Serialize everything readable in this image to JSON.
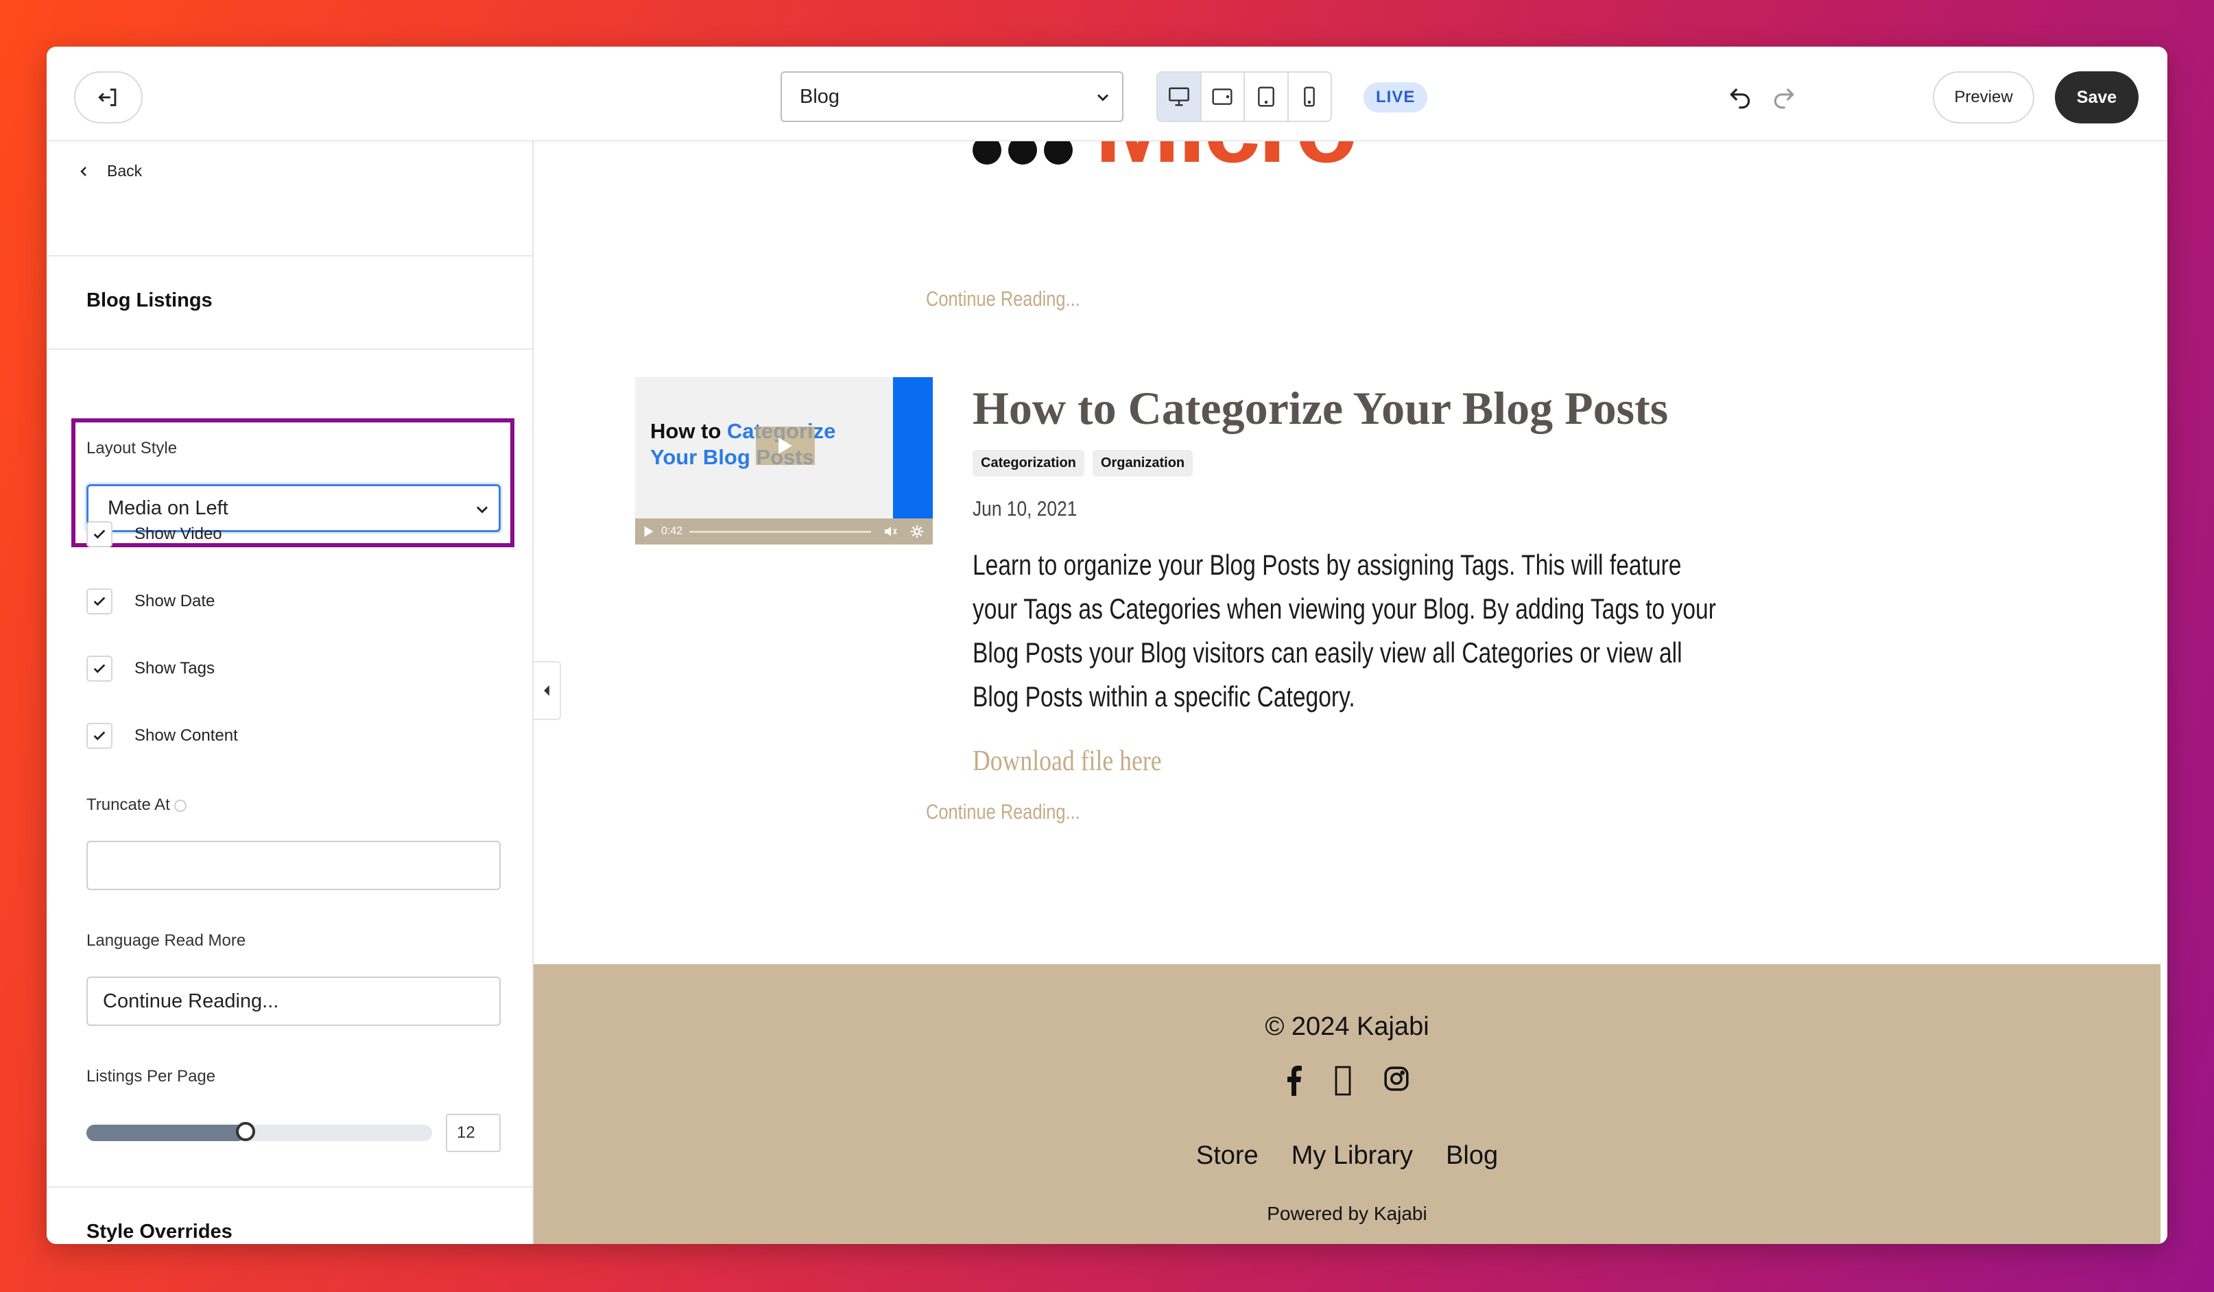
{
  "topbar": {
    "page_select_value": "Blog",
    "live_label": "LIVE",
    "preview_label": "Preview",
    "save_label": "Save"
  },
  "sidebar": {
    "back_label": "Back",
    "section_title": "Blog Listings",
    "layout_style_label": "Layout Style",
    "layout_style_value": "Media on Left",
    "checkboxes": [
      {
        "label": "Show Video",
        "checked": true
      },
      {
        "label": "Show Date",
        "checked": true
      },
      {
        "label": "Show Tags",
        "checked": true
      },
      {
        "label": "Show Content",
        "checked": true
      }
    ],
    "truncate_label": "Truncate At",
    "truncate_value": "",
    "read_more_label": "Language Read More",
    "read_more_value": "Continue Reading...",
    "listings_label": "Listings Per Page",
    "listings_value": "12",
    "listings_fraction": 0.46,
    "style_overrides_title": "Style Overrides"
  },
  "canvas": {
    "logo_text": "Micro",
    "continue_reading_1": "Continue Reading...",
    "video": {
      "title_part1": "How to ",
      "title_part2": "Categorize",
      "title_part3": "Your Blog Posts",
      "time": "0:42"
    },
    "post": {
      "title": "How to Categorize Your Blog Posts",
      "tags": [
        "Categorization",
        "Organization"
      ],
      "date": "Jun 10, 2021",
      "content": "Learn to organize your Blog Posts by assigning Tags. This will feature your Tags as Categories when viewing your Blog. By adding Tags to your Blog Posts your Blog visitors can easily view all Categories or view all Blog Posts within a specific Category.",
      "download": "Download file here",
      "continue_reading": "Continue Reading..."
    },
    "footer": {
      "copyright": "© 2024 Kajabi",
      "social_icons": [
        "facebook-icon",
        "unknown-social-icon",
        "instagram-icon"
      ],
      "nav": [
        "Store",
        "My Library",
        "Blog"
      ],
      "powered_by": "Powered by Kajabi"
    }
  },
  "colors": {
    "accent_purple": "#8a0c8a",
    "footer_bg": "#cbb89b",
    "link_tan": "#c6ab86",
    "save_bg": "#2b2b2b"
  }
}
